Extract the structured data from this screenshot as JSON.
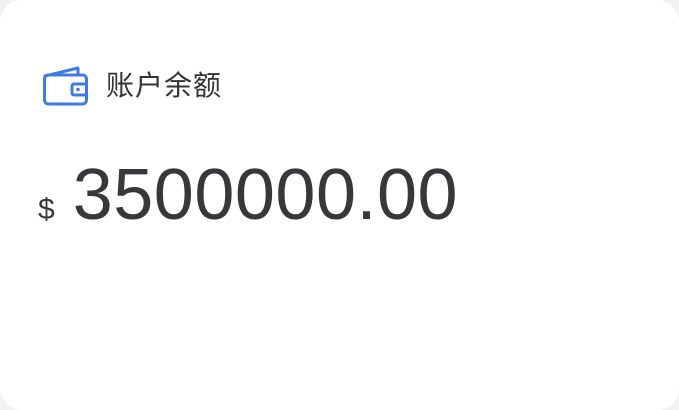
{
  "card": {
    "icon": "wallet-icon",
    "title": "账户余额",
    "currency_symbol": "$",
    "amount": "3500000.00",
    "accent_color": "#3f7be0"
  }
}
